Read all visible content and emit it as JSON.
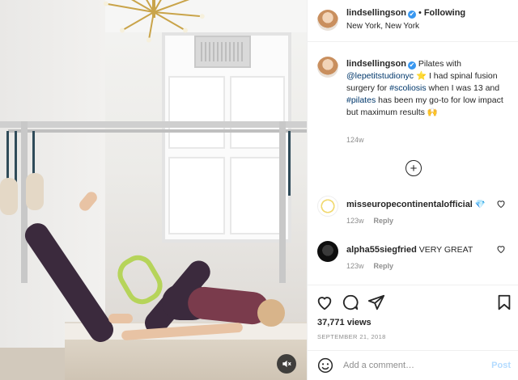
{
  "post": {
    "username": "lindsellingson",
    "follow_label": "Following",
    "location": "New York, New York",
    "caption": {
      "username": "lindsellingson",
      "part1": " Pilates with ",
      "mention": "@lepetitstudionyc",
      "part2": " ⭐ I had spinal fusion surgery for ",
      "tag1": "#scoliosis",
      "part3": " when I was 13 and ",
      "tag2": "#pilates",
      "part4": " has been my go-to for low impact but maximum results 🙌",
      "time": "124w"
    },
    "comments": [
      {
        "username": "misseuropecontinentalofficial",
        "text": " 💎",
        "time": "123w",
        "reply_label": "Reply"
      },
      {
        "username": "alpha55siegfried",
        "text": " VERY GREAT",
        "time": "123w",
        "reply_label": "Reply"
      }
    ],
    "views": "37,771 views",
    "date": "SEPTEMBER 21, 2018",
    "add_comment_placeholder": "Add a comment…",
    "post_label": "Post"
  },
  "icons": {
    "verified": "✔",
    "more": "+",
    "heart": "heart-icon",
    "comment": "comment-icon",
    "share": "share-icon",
    "bookmark": "bookmark-icon",
    "emoji": "emoji-icon",
    "mute": "mute-icon"
  },
  "colors": {
    "link": "#00376b",
    "verified": "#3897f0",
    "post_disabled": "#b3dbff",
    "muted_text": "#8e8e8e"
  }
}
